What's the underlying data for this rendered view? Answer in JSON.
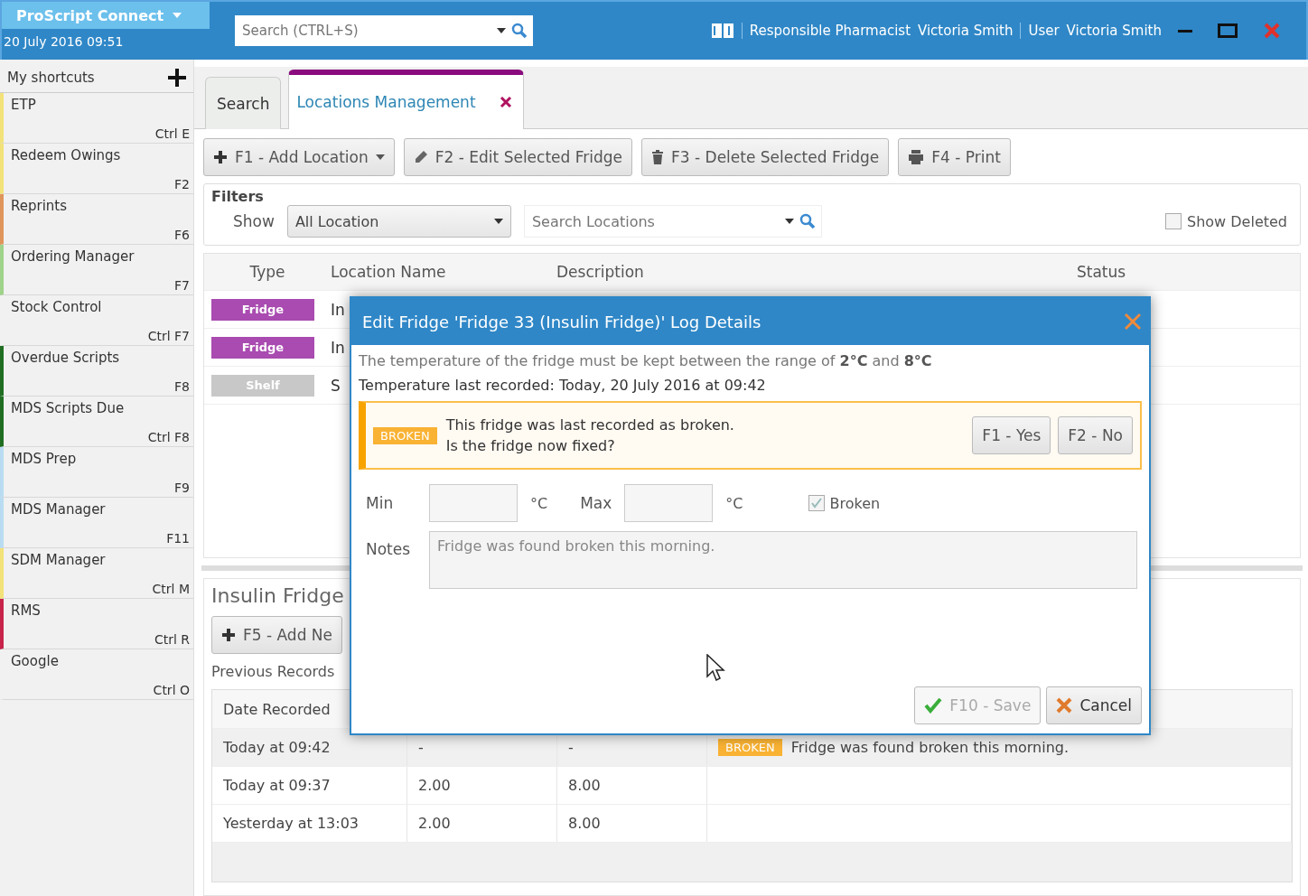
{
  "header": {
    "app_name": "ProScript Connect",
    "datetime": "20 July 2016 09:51",
    "search_placeholder": "Search (CTRL+S)",
    "pharmacist_label": "Responsible Pharmacist",
    "pharmacist": "Victoria Smith",
    "user_label": "User",
    "user": "Victoria Smith"
  },
  "sidebar": {
    "title": "My shortcuts",
    "items": [
      {
        "label": "ETP",
        "shortcut": "Ctrl E",
        "color": "#f3e27a"
      },
      {
        "label": "Redeem Owings",
        "shortcut": "F2",
        "color": "#f3e27a"
      },
      {
        "label": "Reprints",
        "shortcut": "F6",
        "color": "#e0955a"
      },
      {
        "label": "Ordering Manager",
        "shortcut": "F7",
        "color": "#9fd28a"
      },
      {
        "label": "Stock Control",
        "shortcut": "Ctrl F7",
        "color": "#f0f1f0"
      },
      {
        "label": "Overdue Scripts",
        "shortcut": "F8",
        "color": "#1f6e22"
      },
      {
        "label": "MDS Scripts Due",
        "shortcut": "Ctrl F8",
        "color": "#1f6e22"
      },
      {
        "label": "MDS Prep",
        "shortcut": "F9",
        "color": "#b9dcf2"
      },
      {
        "label": "MDS Manager",
        "shortcut": "F11",
        "color": "#b9dcf2"
      },
      {
        "label": "SDM Manager",
        "shortcut": "Ctrl M",
        "color": "#f3e27a"
      },
      {
        "label": "RMS",
        "shortcut": "Ctrl R",
        "color": "#c8234a"
      },
      {
        "label": "Google",
        "shortcut": "Ctrl O",
        "color": "#f0f1f0"
      }
    ]
  },
  "tabs": [
    {
      "label": "Search",
      "selected": false,
      "closable": false
    },
    {
      "label": "Locations Management",
      "selected": true,
      "closable": true
    }
  ],
  "toolbar": [
    {
      "label": "F1 - Add Location",
      "dropdown": true
    },
    {
      "label": "F2 - Edit Selected Fridge",
      "dropdown": false
    },
    {
      "label": "F3 - Delete Selected Fridge",
      "dropdown": false
    },
    {
      "label": "F4 - Print",
      "dropdown": false
    }
  ],
  "filters": {
    "title": "Filters",
    "show_label": "Show",
    "show_value": "All Location",
    "search_placeholder": "Search Locations",
    "show_deleted": {
      "label": "Show Deleted",
      "checked": false
    }
  },
  "locations": {
    "columns": [
      "Type",
      "Location Name",
      "Description",
      "Status"
    ],
    "rows": [
      {
        "type": "Fridge",
        "color": "#a94bb0",
        "name": "In"
      },
      {
        "type": "Fridge",
        "color": "#a94bb0",
        "name": "In"
      },
      {
        "type": "Shelf",
        "color": "#c8c8c8",
        "name": "S"
      }
    ]
  },
  "details": {
    "title": "Insulin Fridge",
    "add_button": "F5 - Add Ne",
    "records_label": "Previous Records",
    "columns": [
      "Date Recorded"
    ],
    "rows": [
      {
        "date": "Today at 09:42",
        "min": "-",
        "max": "-",
        "status": "BROKEN",
        "notes": "Fridge was found broken this morning.",
        "selected": true
      },
      {
        "date": "Today at 09:37",
        "min": "2.00",
        "max": "8.00",
        "selected": false
      },
      {
        "date": "Yesterday at 13:03",
        "min": "2.00",
        "max": "8.00",
        "selected": false
      }
    ]
  },
  "dialog": {
    "title": "Edit Fridge 'Fridge 33 (Insulin Fridge)' Log Details",
    "range_text": "The temperature of the fridge must be kept between the range of **2°C** and **8°C**",
    "last_recorded": "Temperature last recorded: Today, 20 July 2016 at 09:42",
    "alert": {
      "badge": "BROKEN",
      "line1": "This fridge was last recorded as broken.",
      "line2": "Is the fridge now fixed?",
      "buttons": [
        "F1 - Yes",
        "F2 - No"
      ]
    },
    "min_label": "Min",
    "min_unit": "°C",
    "max_label": "Max",
    "max_unit": "°C",
    "broken": {
      "label": "Broken",
      "checked": true
    },
    "notes_label": "Notes",
    "notes": "Fridge was found broken this morning.",
    "save": {
      "label": "F10 - Save",
      "disabled": true
    },
    "cancel": {
      "label": "Cancel"
    }
  }
}
